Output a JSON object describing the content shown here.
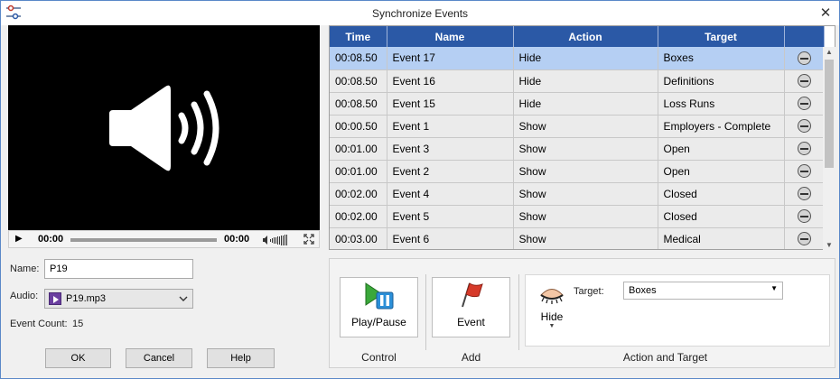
{
  "window": {
    "title": "Synchronize Events",
    "close_glyph": "✕"
  },
  "player": {
    "current_time": "00:00",
    "total_time": "00:00",
    "progress": 0,
    "icons": [
      "speaker-icon",
      "play-icon",
      "volume-icon",
      "fullscreen-icon"
    ]
  },
  "form": {
    "name_label": "Name:",
    "name_value": "P19",
    "audio_label": "Audio:",
    "audio_value": "P19.mp3",
    "event_count_label": "Event Count:",
    "event_count_value": "15"
  },
  "buttons": {
    "ok": "OK",
    "cancel": "Cancel",
    "help": "Help"
  },
  "table": {
    "columns": [
      "Time",
      "Name",
      "Action",
      "Target"
    ],
    "selected_row": 0,
    "rows": [
      {
        "time": "00:08.50",
        "name": "Event 17",
        "action": "Hide",
        "target": "Boxes"
      },
      {
        "time": "00:08.50",
        "name": "Event 16",
        "action": "Hide",
        "target": "Definitions"
      },
      {
        "time": "00:08.50",
        "name": "Event 15",
        "action": "Hide",
        "target": "Loss Runs"
      },
      {
        "time": "00:00.50",
        "name": "Event 1",
        "action": "Show",
        "target": "Employers - Complete"
      },
      {
        "time": "00:01.00",
        "name": "Event 3",
        "action": "Show",
        "target": "Open"
      },
      {
        "time": "00:01.00",
        "name": "Event 2",
        "action": "Show",
        "target": "Open"
      },
      {
        "time": "00:02.00",
        "name": "Event 4",
        "action": "Show",
        "target": "Closed"
      },
      {
        "time": "00:02.00",
        "name": "Event 5",
        "action": "Show",
        "target": "Closed"
      },
      {
        "time": "00:03.00",
        "name": "Event 6",
        "action": "Show",
        "target": "Medical"
      }
    ]
  },
  "ribbon": {
    "play_pause": "Play/Pause",
    "event": "Event",
    "hide": "Hide",
    "target_label": "Target:",
    "target_value": "Boxes",
    "groups": {
      "control": "Control",
      "add": "Add",
      "action_target": "Action and Target"
    }
  },
  "colors": {
    "header": "#2b59a6",
    "selected_row": "#b5cff3",
    "row": "#ebebeb"
  }
}
